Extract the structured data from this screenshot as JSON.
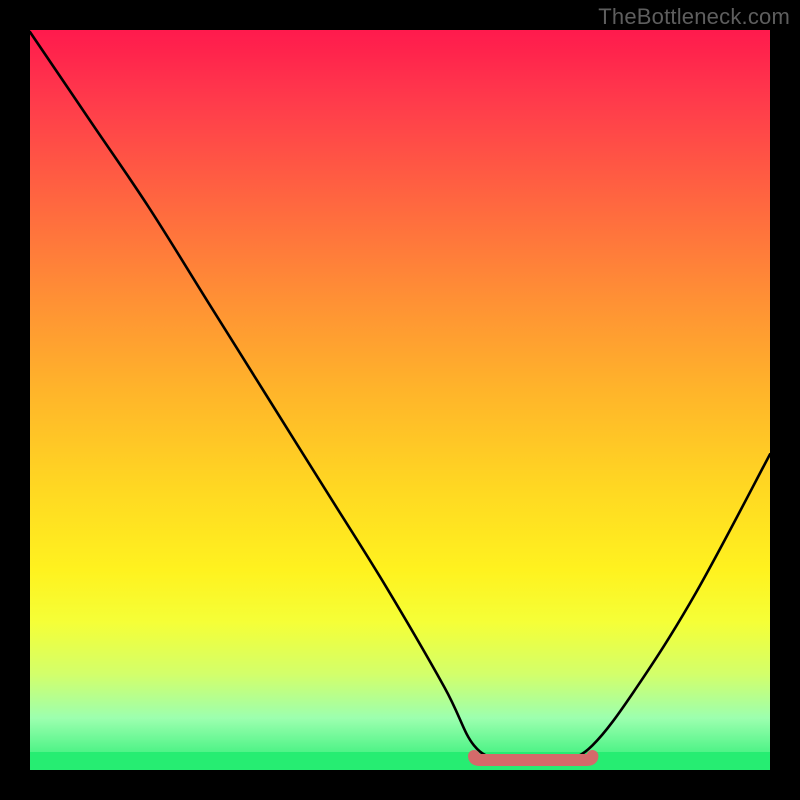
{
  "watermark": "TheBottleneck.com",
  "chart_data": {
    "type": "line",
    "title": "",
    "xlabel": "",
    "ylabel": "",
    "xlim": [
      0,
      100
    ],
    "ylim": [
      0,
      100
    ],
    "grid": false,
    "legend": false,
    "series": [
      {
        "name": "bottleneck-curve",
        "x": [
          0,
          8,
          16,
          24,
          32,
          40,
          48,
          56,
          60,
          64,
          68,
          72,
          76,
          82,
          90,
          100
        ],
        "values": [
          100,
          88,
          76,
          63,
          50,
          37,
          24,
          10,
          2,
          0,
          0,
          0,
          2,
          10,
          23,
          42
        ]
      }
    ],
    "annotations": [
      {
        "name": "flat-bottom-highlight",
        "x_from": 60,
        "x_to": 76,
        "y": 0
      }
    ],
    "background_gradient": [
      {
        "pos": 0.0,
        "color": "#ff1a4d"
      },
      {
        "pos": 0.1,
        "color": "#ff3c4b"
      },
      {
        "pos": 0.23,
        "color": "#ff6640"
      },
      {
        "pos": 0.36,
        "color": "#ff8f35"
      },
      {
        "pos": 0.49,
        "color": "#ffb52a"
      },
      {
        "pos": 0.62,
        "color": "#ffd822"
      },
      {
        "pos": 0.73,
        "color": "#fff21f"
      },
      {
        "pos": 0.8,
        "color": "#f5ff37"
      },
      {
        "pos": 0.87,
        "color": "#d3ff6a"
      },
      {
        "pos": 0.93,
        "color": "#9cffaf"
      },
      {
        "pos": 1.0,
        "color": "#26ed72"
      }
    ]
  }
}
